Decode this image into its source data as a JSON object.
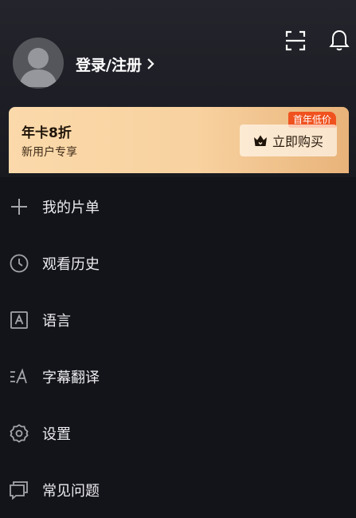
{
  "header": {
    "login_label": "登录/注册",
    "scan_icon": "scan-icon",
    "bell_icon": "bell-icon",
    "avatar_icon": "user-avatar-icon"
  },
  "vip_banner": {
    "title": "年卡8折",
    "subtitle": "新用户专享",
    "badge": "首年低价",
    "buy_label": "立即购买",
    "buy_icon": "crown-icon"
  },
  "menu": {
    "items": [
      {
        "label": "我的片单",
        "icon": "plus-icon"
      },
      {
        "label": "观看历史",
        "icon": "clock-icon"
      },
      {
        "label": "语言",
        "icon": "language-icon"
      },
      {
        "label": "字幕翻译",
        "icon": "subtitle-translate-icon"
      },
      {
        "label": "设置",
        "icon": "gear-icon"
      },
      {
        "label": "常见问题",
        "icon": "chat-bubbles-icon"
      }
    ]
  },
  "colors": {
    "background": "#13141a",
    "header_background": "#24252c",
    "vip_gold_light": "#fbd9aa",
    "vip_gold_dark": "#e8b37a",
    "badge_orange": "#f0521f",
    "icon_gray": "#a4a5ab"
  }
}
